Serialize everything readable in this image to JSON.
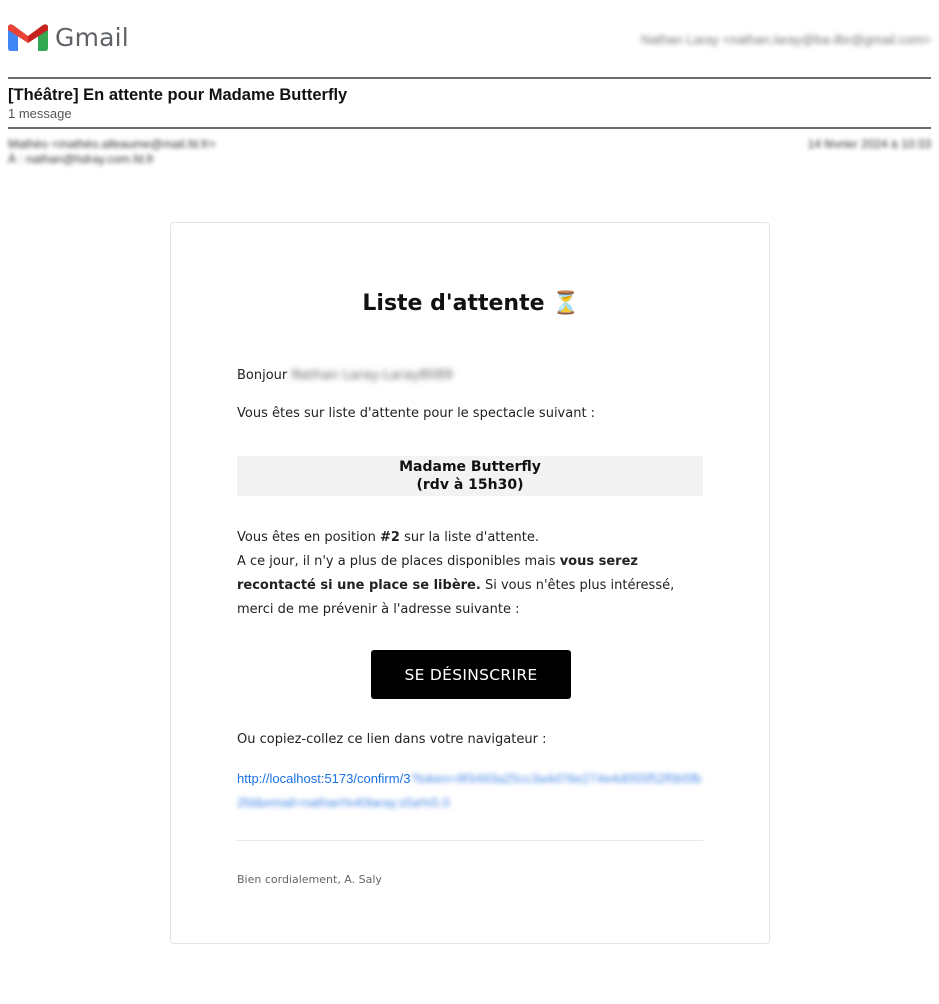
{
  "header": {
    "logo_text": "Gmail",
    "account": "Nathan Laray <nathan.laray@ba-ilbr@gmail.com>",
    "brand_colors": {
      "red": "#EA4335",
      "blue": "#4285F4",
      "green": "#34A853",
      "yellow": "#FBBC04"
    }
  },
  "thread": {
    "subject": "[Théâtre] En attente pour Madame Butterfly",
    "message_count": "1 message"
  },
  "message_meta": {
    "from": "Mathéo <mathéo.alleaume@mail.fd.fr>",
    "to": "À : nathan@hdray.com.fd.fr",
    "date": "14 février 2024 à 10:33"
  },
  "email": {
    "title": "Liste d'attente",
    "title_icon": "⏳",
    "greeting": "Bonjour",
    "recipient_name": "Nathan Laray-Laray8089",
    "intro": "Vous êtes sur liste d'attente pour le spectacle suivant :",
    "show_name": "Madame Butterfly",
    "show_time": "(rdv à 15h30)",
    "position_prefix": "Vous êtes en position ",
    "position_value": "#2",
    "position_suffix": " sur la liste d'attente.",
    "availability_prefix": "A ce jour, il n'y a plus de places disponibles mais ",
    "availability_bold": "vous serez recontacté si une place se libère.",
    "availability_suffix": " Si vous n'êtes plus intéressé, merci de me prévenir à l'adresse suivante :",
    "unsubscribe_button": "SE DÉSINSCRIRE",
    "copy_instruction": "Ou copiez-collez ce lien dans votre navigateur :",
    "link_visible": "http://localhost:5173/confirm/3",
    "link_hidden": "?token=9f3493a25cc3a4d76e274e4d055f52f0b5fb2fd&email=nathan%40laray.s5a%5.0",
    "signature": "Bien cordialement, A. Saly"
  }
}
